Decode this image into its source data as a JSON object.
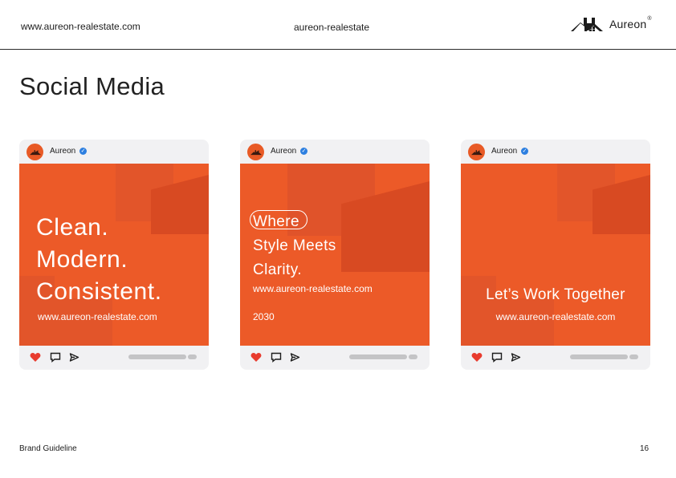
{
  "header": {
    "website": "www.aureon-realestate.com",
    "handle": "aureon-realestate",
    "brand": "Aureon",
    "brand_mark": "®",
    "logo_icon": "house-roof-logo-icon"
  },
  "page": {
    "title": "Social Media"
  },
  "posts": [
    {
      "account": "Aureon",
      "headline": [
        "Clean.",
        "Modern.",
        "Consistent."
      ],
      "url": "www.aureon-realestate.com"
    },
    {
      "account": "Aureon",
      "headline": [
        "Where",
        "Style Meets",
        "Clarity."
      ],
      "url": "www.aureon-realestate.com",
      "year": "2030"
    },
    {
      "account": "Aureon",
      "headline": "Let’s Work Together",
      "url": "www.aureon-realestate.com"
    }
  ],
  "post_icons": [
    "heart-icon",
    "comment-icon",
    "send-icon",
    "verified-icon"
  ],
  "colors": {
    "accent": "#ec5a28",
    "accent_dark": "#d84a22",
    "verify_blue": "#2d7fe0",
    "heart": "#e83b2e",
    "card_bg": "#f1f1f3"
  },
  "footer": {
    "label": "Brand Guideline",
    "page_number": "16"
  }
}
